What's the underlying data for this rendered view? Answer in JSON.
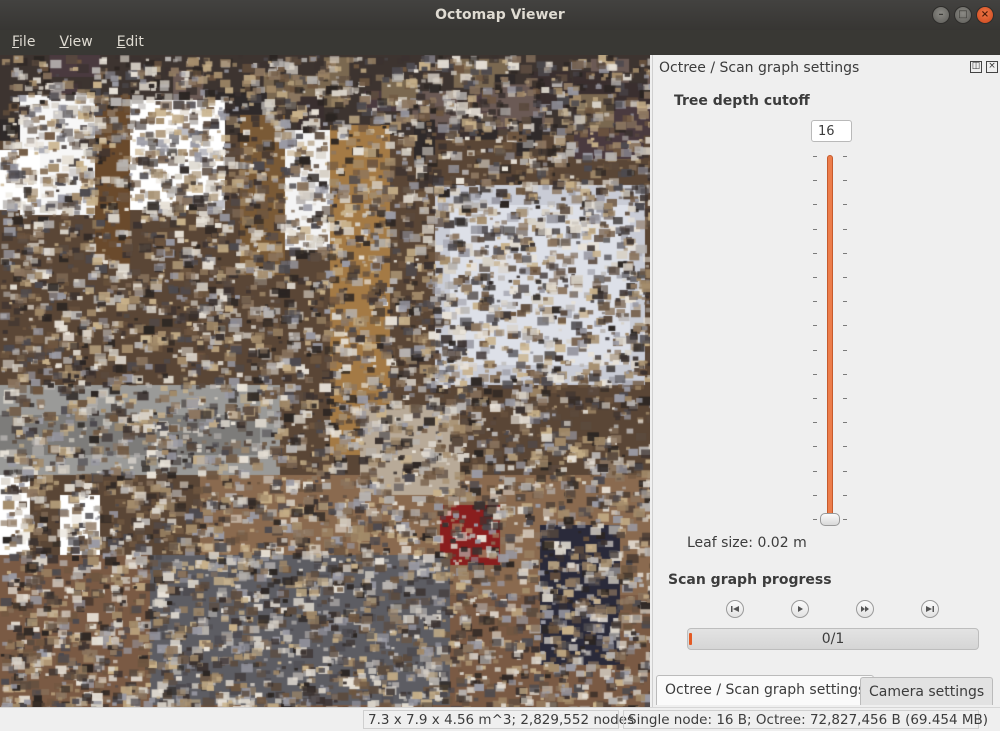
{
  "window": {
    "title": "Octomap Viewer"
  },
  "menubar": {
    "items": [
      {
        "accel": "F",
        "rest": "ile"
      },
      {
        "accel": "V",
        "rest": "iew"
      },
      {
        "accel": "E",
        "rest": "dit"
      }
    ]
  },
  "dock": {
    "title": "Octree / Scan graph settings",
    "tree_depth_label": "Tree depth cutoff",
    "tree_depth_value": "16",
    "slider_level_fraction": 1.0,
    "leaf_size_label": "Leaf size:",
    "leaf_size_value": "0.02 m",
    "scan_progress_label": "Scan graph progress",
    "progress_text": "0/1",
    "progress_fraction": 0.0,
    "media_icons": [
      "skip-to-start-icon",
      "play-icon",
      "fast-forward-icon",
      "skip-to-end-icon"
    ]
  },
  "tabs": [
    {
      "label": "Octree / Scan graph settings",
      "active": true
    },
    {
      "label": "Camera settings",
      "active": false
    }
  ],
  "status": {
    "volume": "7.3 x 7.9 x 4.56 m^3; 2,829,552 nodes",
    "memory": "Single node: 16 B; Octree: 72,827,456 B (69.454 MB)"
  },
  "colors": {
    "accent": "#ec7d4b",
    "titlebar": "#3c3b37",
    "progress": "#e35a24"
  }
}
